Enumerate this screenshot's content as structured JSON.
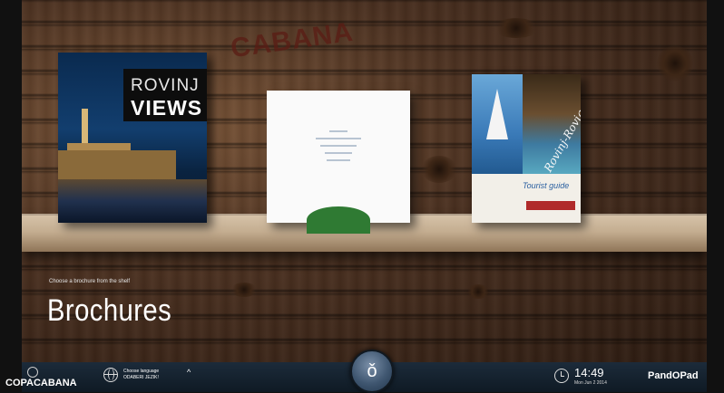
{
  "watermark": "CABANA",
  "shelf": {
    "books": [
      {
        "title_line1": "ROVINJ",
        "title_line2": "VIEWS"
      },
      {
        "lines": [
          "",
          "",
          "",
          "",
          ""
        ]
      },
      {
        "script_title": "Rovinj-Rovigno",
        "subtitle": "Tourist guide"
      }
    ]
  },
  "hint": "Choose a brochure from the shelf",
  "heading": "Brochures",
  "bottom_bar": {
    "logo": "COPACABANA",
    "language": {
      "line1": "Choose language",
      "line2": "ODABERI JEZIK!"
    },
    "chevron": "^",
    "home_icon": "ǒ",
    "time": "14:49",
    "date": "Mon Jun 2 2014",
    "brand": "PandOPad"
  }
}
